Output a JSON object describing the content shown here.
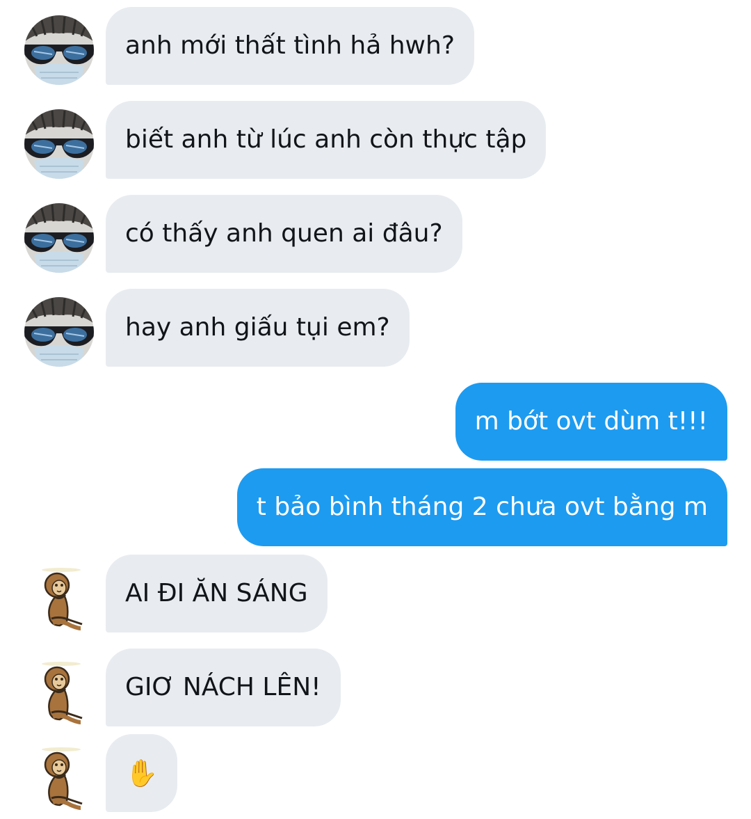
{
  "colors": {
    "incoming_bubble": "#e8ecf0",
    "outgoing_bubble": "#1d9bf0",
    "incoming_text": "#111418",
    "outgoing_text": "#ffffff"
  },
  "messages": [
    {
      "sender": "contact-1",
      "avatar_icon": "sunglasses-avatar",
      "text": "anh mới thất tình hả hwh?"
    },
    {
      "sender": "contact-1",
      "avatar_icon": "sunglasses-avatar",
      "text": "biết anh từ lúc anh còn thực tập"
    },
    {
      "sender": "contact-1",
      "avatar_icon": "sunglasses-avatar",
      "text": "có thấy anh quen ai đâu?"
    },
    {
      "sender": "contact-1",
      "avatar_icon": "sunglasses-avatar",
      "text": "hay anh giấu tụi em?"
    },
    {
      "sender": "me",
      "text": "m bớt ovt dùm t!!!"
    },
    {
      "sender": "me",
      "text": "t bảo bình tháng 2 chưa ovt bằng m"
    },
    {
      "sender": "contact-2",
      "avatar_icon": "monkey-sticker-avatar",
      "text": "AI ĐI ĂN SÁNG"
    },
    {
      "sender": "contact-2",
      "avatar_icon": "monkey-sticker-avatar",
      "text": "GIƠ NÁCH LÊN!"
    },
    {
      "sender": "contact-2",
      "avatar_icon": "monkey-sticker-avatar",
      "text": "✋",
      "icon": "raised-hand-emoji"
    }
  ]
}
